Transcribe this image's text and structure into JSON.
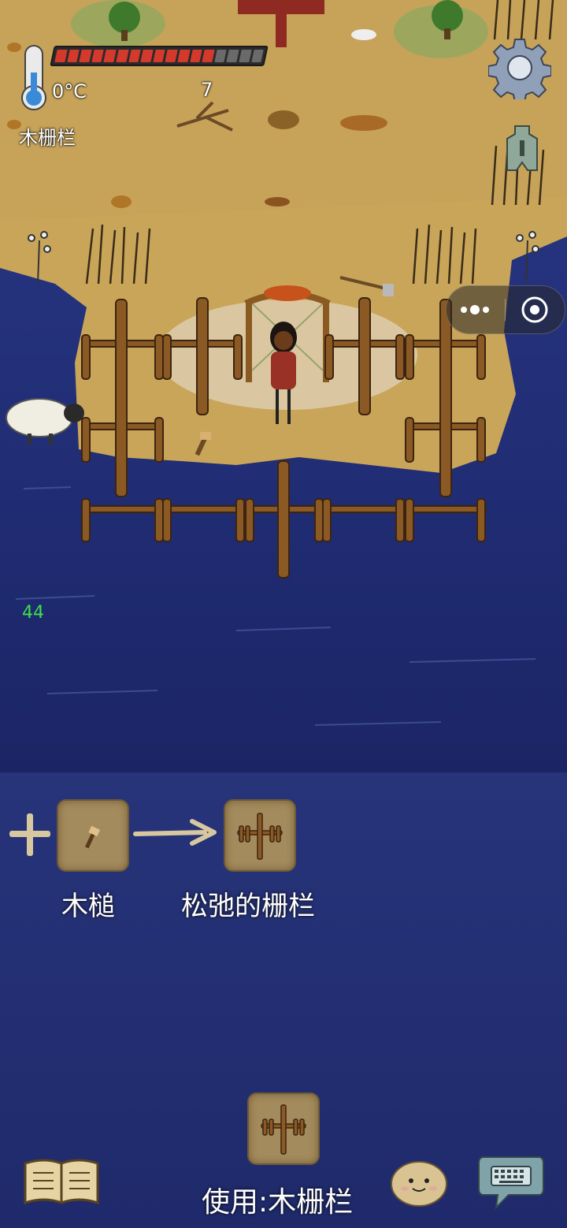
{
  "hud": {
    "temperature": "0°C",
    "food_pips_filled": 13,
    "food_pips_total": 17,
    "item_count": "7",
    "hovered_item": "木栅栏",
    "fps": "44"
  },
  "icons": {
    "settings": "gear-icon",
    "coin": "spade-coin-icon",
    "thermometer": "thermometer-icon",
    "capsule_more": "more-dots-icon",
    "capsule_close": "target-close-icon",
    "recipe_book": "book-icon",
    "emote": "face-emote-icon",
    "chat": "keyboard-chat-icon"
  },
  "craft_hint": {
    "ingredient_label": "木槌",
    "result_label": "松弛的栅栏"
  },
  "bottom": {
    "use_label": "使用:木栅栏"
  },
  "colors": {
    "water": "#1f2a6b",
    "grass": "#c9a55a",
    "slot": "#a48b5d",
    "food_full": "#d33a2c",
    "food_empty": "#6a6a6a",
    "fps": "#3fe04c"
  }
}
